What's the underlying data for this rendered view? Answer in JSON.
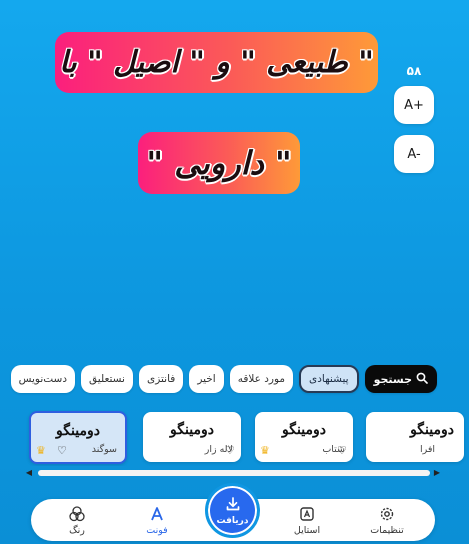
{
  "preview": {
    "line1": "\" طبیعی \" و \" اصیل \" با",
    "line2": "\" دارویی \""
  },
  "size_control": {
    "value": "۵۸",
    "plus_label": "A+",
    "minus_label": "A-"
  },
  "chips": {
    "search_label": "جستجو",
    "items": [
      "پیشنهادی",
      "مورد علاقه",
      "اخیر",
      "فانتزی",
      "نستعلیق",
      "دست‌نویس"
    ]
  },
  "cards": [
    {
      "sample": "دومینگو",
      "name": "سوگند",
      "premium": true
    },
    {
      "sample": "دومینگو",
      "name": "لاله زار",
      "premium": false
    },
    {
      "sample": "دومینگو",
      "name": "شتاب",
      "premium": true
    },
    {
      "sample": "دومینگو",
      "name": "افرا",
      "premium": false
    }
  ],
  "nav": {
    "settings": "تنظیمات",
    "style": "استایل",
    "download": "دریافت",
    "font": "فونت",
    "color": "رنگ"
  },
  "colors": {
    "accent": "#2a67e8",
    "background": "#0d97df",
    "preview_gradient_start": "#fb1f7d",
    "preview_gradient_end": "#fe9a38"
  }
}
